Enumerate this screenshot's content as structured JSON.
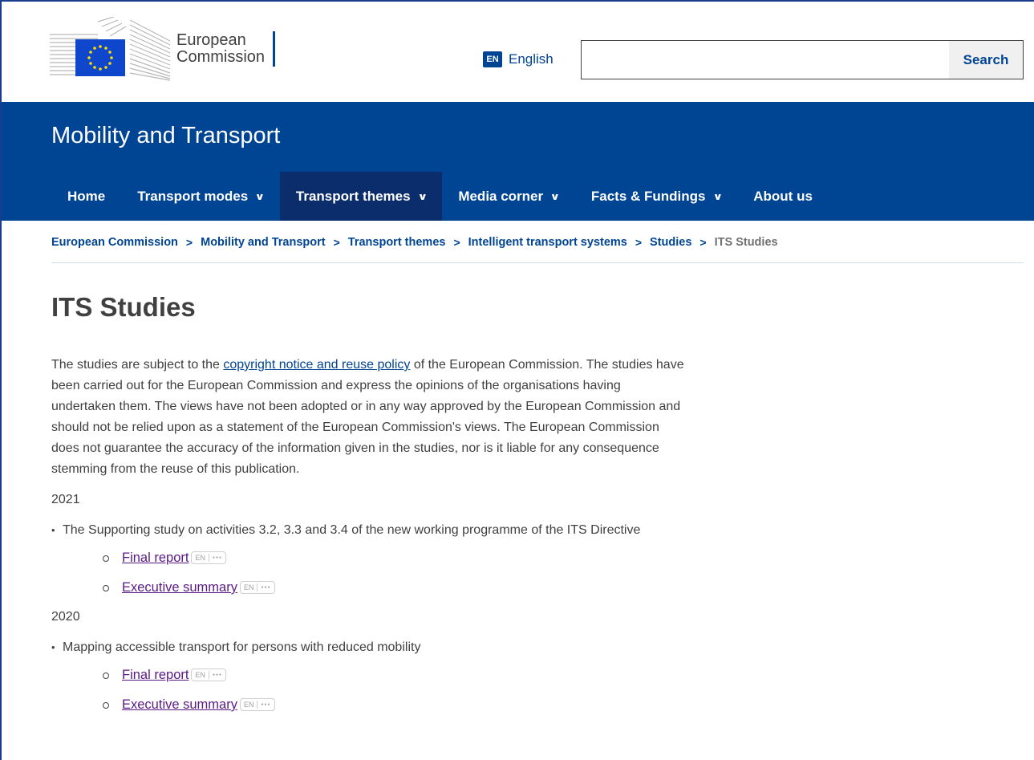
{
  "header": {
    "logo_line1": "European",
    "logo_line2": "Commission",
    "language_code": "EN",
    "language_label": "English",
    "search_placeholder": "",
    "search_button": "Search"
  },
  "site": {
    "title": "Mobility and Transport",
    "nav": [
      {
        "label": "Home",
        "dropdown": false
      },
      {
        "label": "Transport modes",
        "dropdown": true
      },
      {
        "label": "Transport themes",
        "dropdown": true,
        "active": true
      },
      {
        "label": "Media corner",
        "dropdown": true
      },
      {
        "label": "Facts & Fundings",
        "dropdown": true
      },
      {
        "label": "About us",
        "dropdown": false
      }
    ]
  },
  "breadcrumb": {
    "items": [
      "European Commission",
      "Mobility and Transport",
      "Transport themes",
      "Intelligent transport systems",
      "Studies"
    ],
    "current": "ITS Studies"
  },
  "page": {
    "title": "ITS Studies",
    "intro_before": "The studies are subject to the ",
    "intro_link": "copyright notice and reuse policy",
    "intro_after": " of the European Commission. The studies have been carried out for the European Commission and express the opinions of the organisations having undertaken them. The views have not been adopted or in any way approved by the European Commission and should not be relied upon as a statement of the European Commission's views. The European Commission does not guarantee the accuracy of the information given in the studies, nor is it liable for any consequence stemming from the reuse of this publication.",
    "sections": [
      {
        "year": "2021",
        "study": "The Supporting study on activities 3.2, 3.3 and 3.4 of the new working programme of the ITS Directive",
        "docs": [
          {
            "label": "Final report",
            "lang": "EN"
          },
          {
            "label": "Executive summary",
            "lang": "EN"
          }
        ]
      },
      {
        "year": "2020",
        "study": "Mapping accessible transport for persons with reduced mobility",
        "docs": [
          {
            "label": "Final report",
            "lang": "EN"
          },
          {
            "label": "Executive summary",
            "lang": "EN"
          }
        ]
      }
    ]
  },
  "colors": {
    "primary": "#004494",
    "active_nav": "#0b2d6b",
    "visited_link": "#5a1a86",
    "text": "#404040"
  }
}
